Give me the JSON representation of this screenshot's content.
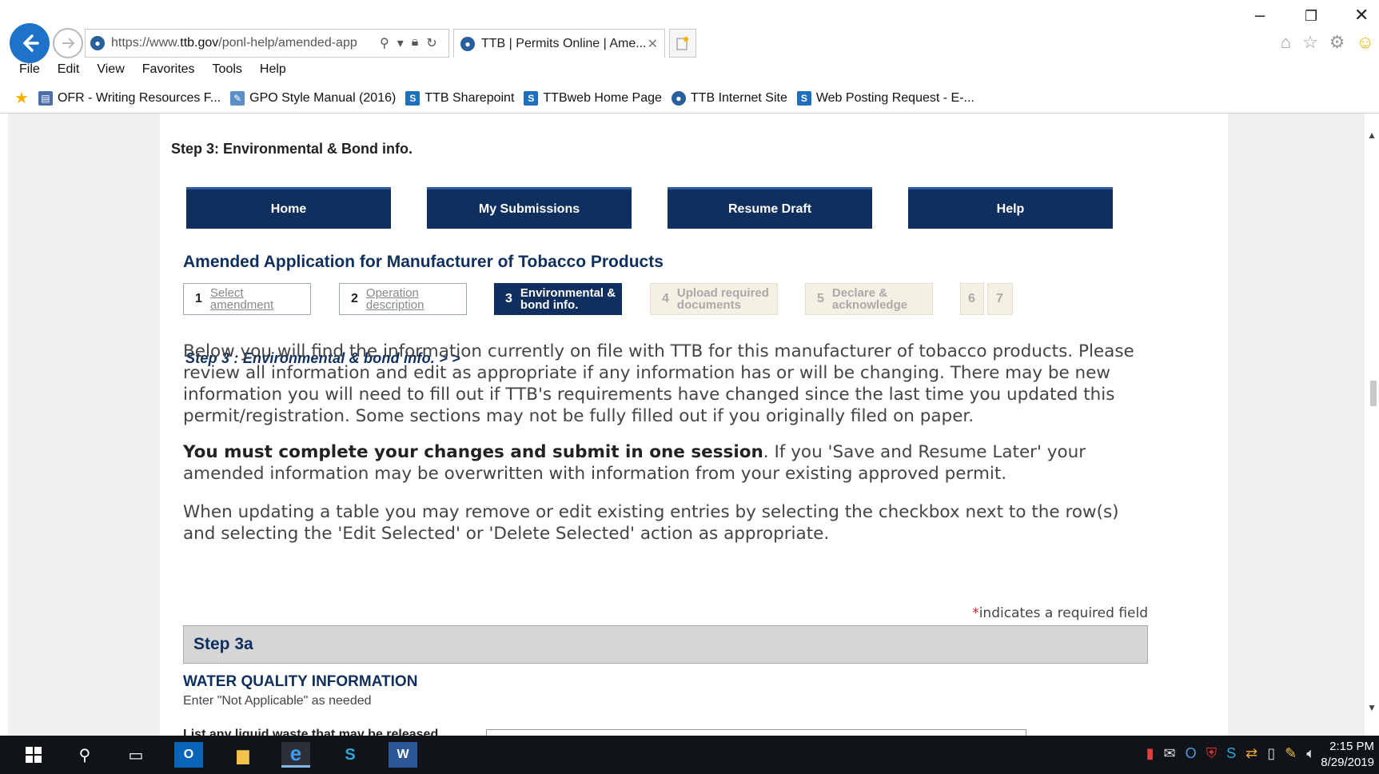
{
  "browser": {
    "url_prefix": "https://www.",
    "url_domain": "ttb.gov",
    "url_rest": "/ponl-help/amended-app",
    "tab_title": "TTB | Permits Online | Ame...",
    "tab_close": "✕",
    "window_controls": {
      "minimize": "–",
      "restore": "❐",
      "close": "✕"
    },
    "menu": [
      "File",
      "Edit",
      "View",
      "Favorites",
      "Tools",
      "Help"
    ],
    "favorites": [
      {
        "label": "OFR - Writing Resources F...",
        "icon": "document-icon"
      },
      {
        "label": "GPO Style Manual (2016)",
        "icon": "gpo-icon"
      },
      {
        "label": "TTB Sharepoint",
        "icon": "sharepoint-icon"
      },
      {
        "label": "TTBweb Home Page",
        "icon": "sharepoint-icon"
      },
      {
        "label": "TTB Internet Site",
        "icon": "ttb-icon"
      },
      {
        "label": "Web Posting Request - E-...",
        "icon": "sharepoint-icon"
      }
    ]
  },
  "page": {
    "step_header": "Step 3: Environmental & Bond info.",
    "nav": {
      "home": "Home",
      "submissions": "My Submissions",
      "resume": "Resume Draft",
      "help": "Help"
    },
    "app_title": "Amended Application for Manufacturer of Tobacco Products",
    "wizard": [
      {
        "num": "1",
        "line1": "Select",
        "line2": "amendment",
        "state": "done"
      },
      {
        "num": "2",
        "line1": "Operation",
        "line2": "description",
        "state": "done"
      },
      {
        "num": "3",
        "line1": "Environmental &",
        "line2": "bond info.",
        "state": "current"
      },
      {
        "num": "4",
        "line1": "Upload required",
        "line2": "documents",
        "state": "todo"
      },
      {
        "num": "5",
        "line1": "Declare &",
        "line2": "acknowledge",
        "state": "todo"
      },
      {
        "num": "6",
        "line1": "",
        "line2": "",
        "state": "todo"
      },
      {
        "num": "7",
        "line1": "",
        "line2": "",
        "state": "todo"
      }
    ],
    "intro_head": "Step 3 : Environmental & bond info. > >",
    "para1": "Below you will find the information currently on file with TTB for this manufacturer of tobacco products. Please review all information and edit as appropriate if any information has or will be changing. There may be new information you will need to fill out if TTB's requirements have changed since the last time you updated this permit/registration. Some sections may not be fully filled out if you originally filed on paper.",
    "para2_bold": "You must complete your changes and submit in one session",
    "para2_rest": ". If you 'Save and Resume Later' your amended information may be overwritten with information from your existing approved permit.",
    "para3": "When updating a table you may remove or edit existing entries by selecting the checkbox next to the row(s) and selecting the 'Edit Selected' or 'Delete Selected' action as appropriate.",
    "required_star": "*",
    "required_note": "indicates a required field",
    "section_title": "Step 3a",
    "water_title": "WATER QUALITY INFORMATION",
    "water_sub": "Enter \"Not Applicable\" as needed",
    "cut_label": "List any liquid waste that may be released"
  },
  "taskbar": {
    "time": "2:15 PM",
    "date": "8/29/2019"
  },
  "colors": {
    "navy": "#0f2f5f",
    "ie_blue": "#1e73c8",
    "grey_band": "#d6d6d7"
  }
}
